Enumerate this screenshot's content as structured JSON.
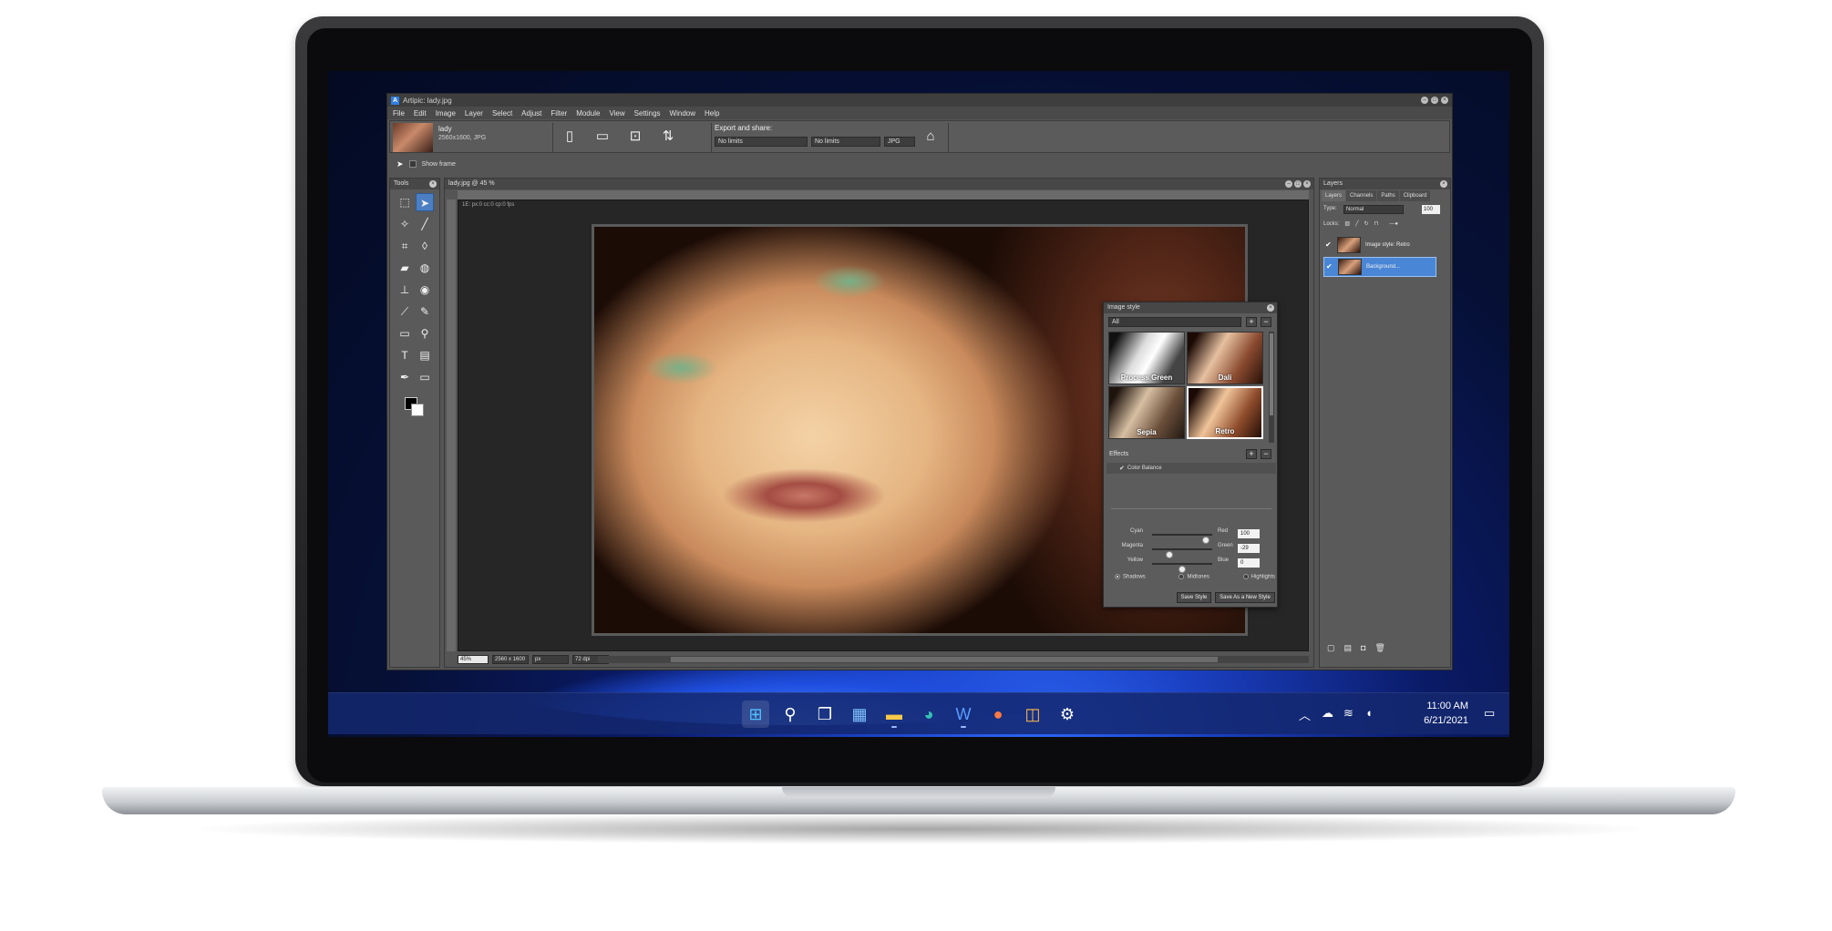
{
  "window": {
    "title": "Artipic: lady.jpg",
    "menu": [
      "File",
      "Edit",
      "Image",
      "Layer",
      "Select",
      "Adjust",
      "Filter",
      "Module",
      "View",
      "Settings",
      "Window",
      "Help"
    ]
  },
  "toolbar": {
    "doc_name": "lady",
    "doc_meta": "2560x1600,  JPG",
    "export_label": "Export and share:",
    "size_limit_1": "No limits",
    "size_limit_2": "No limits",
    "format": "JPG",
    "icons": [
      "new-document-icon",
      "open-folder-icon",
      "save-icon",
      "resize-icon",
      "share-icon"
    ]
  },
  "options": {
    "show_frame_label": "Show frame"
  },
  "tools_panel": {
    "title": "Tools",
    "icons": [
      "rect-select-icon",
      "move-arrow-icon",
      "magic-wand-icon",
      "brush-icon",
      "crop-icon",
      "drop-icon",
      "eraser-icon",
      "color-picker-icon",
      "stamp-icon",
      "eye-icon",
      "eyedropper-icon",
      "pen-icon",
      "gradient-icon",
      "zoom-icon",
      "text-icon",
      "fill-icon",
      "pen-tool-icon",
      "shape-icon"
    ],
    "fg_color": "#000000",
    "bg_color": "#ffffff"
  },
  "document": {
    "title": "lady.jpg @ 45 %",
    "coords": "1E: px:0  cc:0  cp:0  fps",
    "zoom": "45%",
    "dimensions": "2560 x 1600",
    "unit": "px",
    "dpi": "72 dpi"
  },
  "style_dialog": {
    "title": "Image style",
    "filter": "All",
    "styles": [
      {
        "name": "Process Green"
      },
      {
        "name": "Dali"
      },
      {
        "name": "Sepia"
      },
      {
        "name": "Retro",
        "selected": true
      }
    ],
    "effects_label": "Effects",
    "effect_item": "Color Balance",
    "sliders": [
      {
        "left": "Cyan",
        "right": "Red",
        "value": "100",
        "level": 0.95
      },
      {
        "left": "Magenta",
        "right": "Green",
        "value": "-29",
        "level": 0.25
      },
      {
        "left": "Yellow",
        "right": "Blue",
        "value": "0",
        "level": 0.5
      }
    ],
    "radios": [
      "Shadows",
      "Midtones",
      "Highlights"
    ],
    "radio_selected": "Shadows",
    "save_style": "Save Style",
    "save_new_style": "Save As a New Style"
  },
  "layers_panel": {
    "title": "Layers",
    "tabs": [
      "Layers",
      "Channels",
      "Paths",
      "Clipboard"
    ],
    "type_label": "Type:",
    "blend_mode": "Normal",
    "opacity": "100",
    "locks_label": "Locks:",
    "layers": [
      {
        "name": "Image style: Retro",
        "selected": false
      },
      {
        "name": "Background...",
        "selected": true
      }
    ]
  },
  "taskbar": {
    "apps": [
      "start-icon",
      "search-icon",
      "task-view-icon",
      "widgets-icon",
      "file-explorer-icon",
      "edge-icon",
      "word-icon",
      "powerpoint-icon",
      "store-icon",
      "steam-icon"
    ],
    "time": "11:00 AM",
    "date": "6/21/2021"
  }
}
